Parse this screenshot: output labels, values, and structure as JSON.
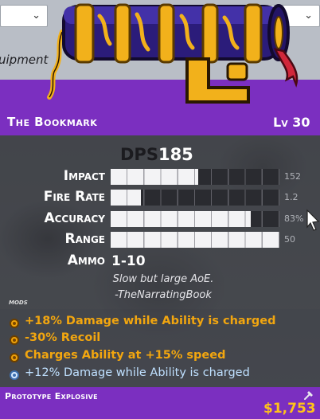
{
  "background": {
    "left_dropdown": {
      "value": "",
      "icon": "chevron-down-icon"
    },
    "right_dropdown": {
      "value": "",
      "icon": "chevron-down-icon"
    },
    "equipment_label": "uipment"
  },
  "item": {
    "name": "The Bookmark",
    "level": "Lv 30",
    "rarity": "Prototype Explosive",
    "price": "$1,753",
    "colors": {
      "rarity": "#7b2fc0",
      "mod": "#f2a60f",
      "special_mod": "#bfe0ff",
      "price": "#ffc21a"
    }
  },
  "stats": {
    "dps_label": "DPS",
    "dps_value": "185",
    "rows": [
      {
        "label": "Impact",
        "value": "152",
        "fill": 0.52
      },
      {
        "label": "Fire Rate",
        "value": "1.2",
        "fill": 0.18
      },
      {
        "label": "Accuracy",
        "value": "83%",
        "fill": 0.83
      },
      {
        "label": "Range",
        "value": "50",
        "fill": 1.0
      }
    ],
    "ammo_label": "Ammo",
    "ammo_value": "1-10"
  },
  "description": {
    "line1": "Slow but large AoE.",
    "line2": "-TheNarratingBook"
  },
  "mods_label": "MODS",
  "mods": [
    {
      "text": "+18% Damage while Ability is charged",
      "style": "gold"
    },
    {
      "text": "-30% Recoil",
      "style": "gold"
    },
    {
      "text": "Charges Ability at +15% speed",
      "style": "gold"
    },
    {
      "text": "+12% Damage while Ability is charged",
      "style": "blue"
    }
  ]
}
